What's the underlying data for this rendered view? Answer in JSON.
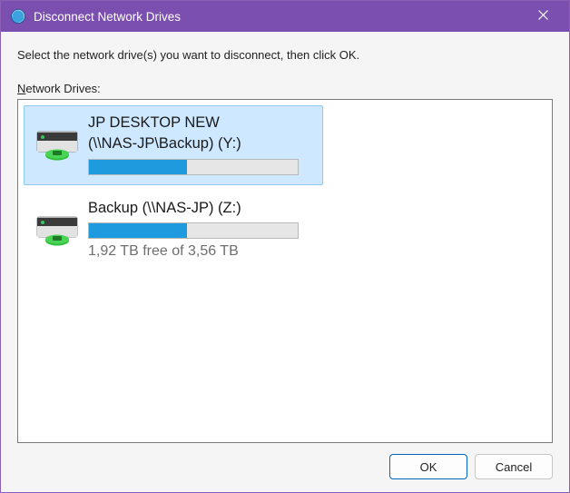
{
  "window": {
    "title": "Disconnect Network Drives"
  },
  "instruction": "Select the network drive(s) you want to disconnect, then click OK.",
  "list_label_prefix": "N",
  "list_label_rest": "etwork Drives:",
  "drives": [
    {
      "name": "JP DESKTOP NEW",
      "path": "(\\\\NAS-JP\\Backup) (Y:)",
      "fill_percent": 47,
      "free_text": "",
      "selected": true
    },
    {
      "name": "Backup (\\\\NAS-JP) (Z:)",
      "path": "",
      "fill_percent": 47,
      "free_text": "1,92 TB free of 3,56 TB",
      "selected": false
    }
  ],
  "buttons": {
    "ok": "OK",
    "cancel": "Cancel"
  }
}
